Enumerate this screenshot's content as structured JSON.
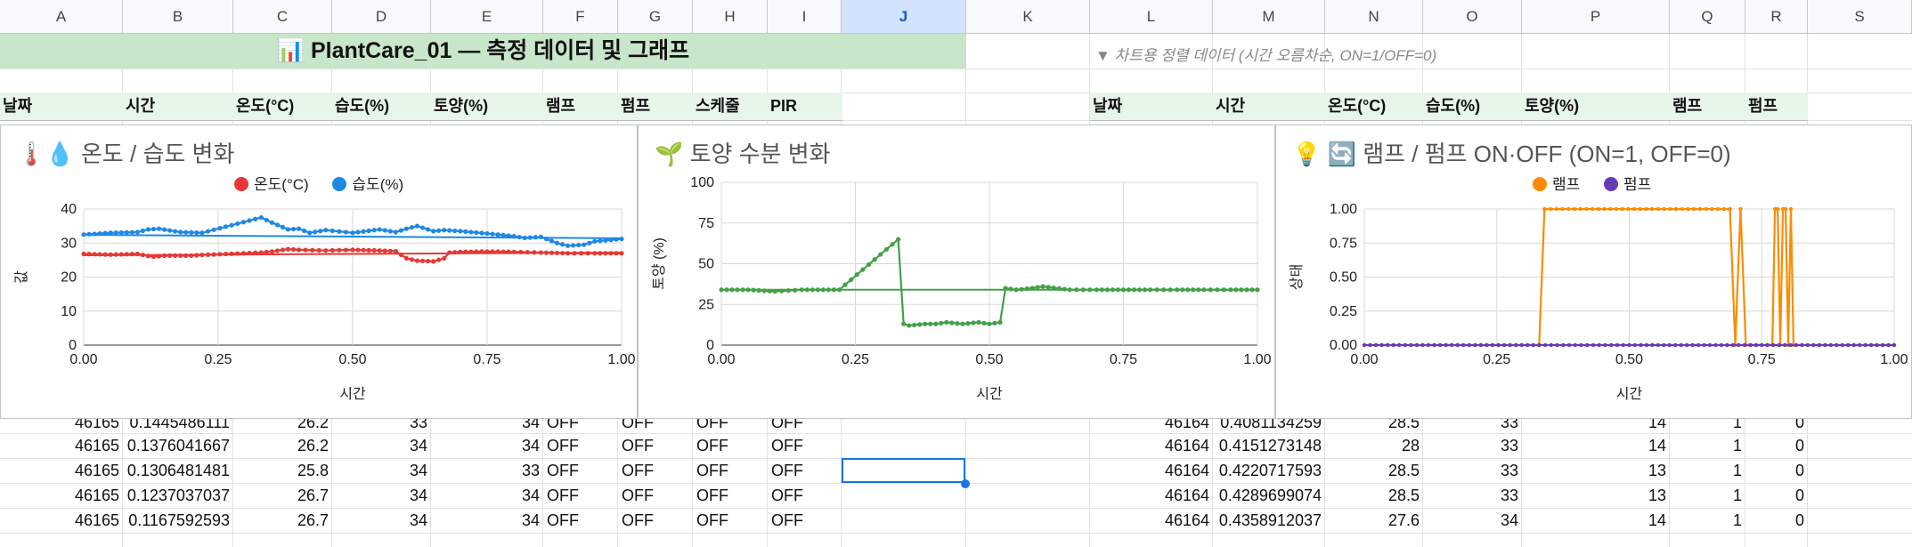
{
  "columns": [
    "A",
    "B",
    "C",
    "D",
    "E",
    "F",
    "G",
    "H",
    "I",
    "J",
    "K",
    "L",
    "M",
    "N",
    "O",
    "P",
    "Q",
    "R",
    "S"
  ],
  "selected_column": "J",
  "title": "📊 PlantCare_01 — 측정 데이터 및 그래프",
  "note": "▼ 차트용 정렬 데이터 (시간 오름차순, ON=1/OFF=0)",
  "left_headers": [
    "날짜",
    "시간",
    "온도(°C)",
    "습도(%)",
    "토양(%)",
    "램프",
    "펌프",
    "스케줄",
    "PIR"
  ],
  "right_headers": [
    "날짜",
    "시간",
    "온도(°C)",
    "습도(%)",
    "토양(%)",
    "램프",
    "펌프"
  ],
  "left_rows": [
    [
      "46165",
      "0.1445486111",
      "26.2",
      "33",
      "34",
      "OFF",
      "OFF",
      "OFF",
      "OFF"
    ],
    [
      "46165",
      "0.1376041667",
      "26.2",
      "34",
      "34",
      "OFF",
      "OFF",
      "OFF",
      "OFF"
    ],
    [
      "46165",
      "0.1306481481",
      "25.8",
      "34",
      "33",
      "OFF",
      "OFF",
      "OFF",
      "OFF"
    ],
    [
      "46165",
      "0.1237037037",
      "26.7",
      "34",
      "34",
      "OFF",
      "OFF",
      "OFF",
      "OFF"
    ],
    [
      "46165",
      "0.1167592593",
      "26.7",
      "34",
      "34",
      "OFF",
      "OFF",
      "OFF",
      "OFF"
    ]
  ],
  "right_rows": [
    [
      "46164",
      "0.4081134259",
      "28.5",
      "33",
      "14",
      "1",
      "0"
    ],
    [
      "46164",
      "0.4151273148",
      "28",
      "33",
      "14",
      "1",
      "0"
    ],
    [
      "46164",
      "0.4220717593",
      "28.5",
      "33",
      "13",
      "1",
      "0"
    ],
    [
      "46164",
      "0.4289699074",
      "28.5",
      "33",
      "13",
      "1",
      "0"
    ],
    [
      "46164",
      "0.4358912037",
      "27.6",
      "34",
      "14",
      "1",
      "0"
    ]
  ],
  "colors": {
    "temp": "#e53935",
    "humid": "#1e88e5",
    "soil": "#43a047",
    "lamp": "#fb8c00",
    "pump": "#673ab7",
    "title_bg": "#c8e6c9",
    "header_bg": "#e8f5e9"
  },
  "chart_data": [
    {
      "type": "line",
      "title": "🌡️💧 온도 / 습도 변화",
      "xlabel": "시간",
      "ylabel": "값",
      "xlim": [
        0,
        1
      ],
      "ylim": [
        0,
        40
      ],
      "xticks": [
        "0.00",
        "0.25",
        "0.50",
        "0.75",
        "1.00"
      ],
      "yticks": [
        "0",
        "10",
        "20",
        "30",
        "40"
      ],
      "legend": "top",
      "grid": true,
      "series": [
        {
          "name": "온도(°C)",
          "color": "#e53935",
          "x": [
            0.0,
            0.05,
            0.1,
            0.12,
            0.13,
            0.15,
            0.2,
            0.22,
            0.33,
            0.35,
            0.38,
            0.4,
            0.45,
            0.5,
            0.55,
            0.58,
            0.6,
            0.62,
            0.65,
            0.67,
            0.68,
            0.7,
            0.75,
            0.8,
            0.85,
            0.9,
            0.95,
            1.0
          ],
          "y": [
            26.8,
            26.6,
            26.8,
            26.2,
            26.0,
            26.3,
            26.3,
            26.5,
            27.2,
            27.5,
            28.2,
            28.0,
            27.8,
            28.0,
            27.8,
            27.6,
            25.5,
            24.8,
            24.6,
            25.5,
            27.2,
            27.4,
            27.5,
            27.4,
            27.2,
            27.0,
            27.0,
            27.0
          ]
        },
        {
          "name": "습도(%)",
          "color": "#1e88e5",
          "x": [
            0.0,
            0.05,
            0.1,
            0.12,
            0.14,
            0.18,
            0.22,
            0.33,
            0.35,
            0.38,
            0.4,
            0.42,
            0.45,
            0.5,
            0.55,
            0.58,
            0.6,
            0.62,
            0.65,
            0.67,
            0.7,
            0.75,
            0.8,
            0.82,
            0.85,
            0.88,
            0.9,
            0.93,
            0.95,
            1.0
          ],
          "y": [
            32.5,
            33.0,
            33.2,
            34.0,
            34.2,
            33.2,
            33.0,
            37.5,
            36.0,
            34.0,
            34.2,
            33.0,
            33.8,
            33.0,
            34.0,
            33.2,
            34.2,
            35.0,
            33.5,
            33.8,
            33.5,
            32.8,
            32.0,
            31.5,
            31.8,
            30.0,
            29.2,
            29.5,
            30.5,
            31.2
          ]
        }
      ],
      "trendlines": [
        {
          "series": "온도(°C)",
          "y0": 26.4,
          "y1": 27.2
        },
        {
          "series": "습도(%)",
          "y0": 32.4,
          "y1": 31.4
        }
      ]
    },
    {
      "type": "line",
      "title": "🌱 토양 수분 변화",
      "xlabel": "시간",
      "ylabel": "토양 (%)",
      "xlim": [
        0,
        1
      ],
      "ylim": [
        0,
        100
      ],
      "xticks": [
        "0.00",
        "0.25",
        "0.50",
        "0.75",
        "1.00"
      ],
      "yticks": [
        "0",
        "25",
        "50",
        "75",
        "100"
      ],
      "grid": true,
      "series": [
        {
          "name": "토양(%)",
          "color": "#43a047",
          "x": [
            0.0,
            0.05,
            0.1,
            0.15,
            0.2,
            0.22,
            0.33,
            0.34,
            0.35,
            0.38,
            0.4,
            0.42,
            0.45,
            0.48,
            0.5,
            0.52,
            0.53,
            0.55,
            0.58,
            0.6,
            0.65,
            0.7,
            0.75,
            0.8,
            0.85,
            0.9,
            0.95,
            1.0
          ],
          "y": [
            34,
            34,
            33,
            34,
            34,
            34,
            65,
            13,
            12,
            13,
            13,
            14,
            13,
            14,
            13,
            14,
            35,
            34,
            35,
            36,
            34,
            34,
            34,
            34,
            34,
            34,
            34,
            34
          ]
        }
      ],
      "trendlines": [
        {
          "series": "토양(%)",
          "y0": 34,
          "y1": 34
        }
      ]
    },
    {
      "type": "line",
      "title": "💡 🔄 램프 / 펌프 ON·OFF (ON=1, OFF=0)",
      "xlabel": "시간",
      "ylabel": "상태",
      "xlim": [
        0,
        1
      ],
      "ylim": [
        0,
        1
      ],
      "xticks": [
        "0.00",
        "0.25",
        "0.50",
        "0.75",
        "1.00"
      ],
      "yticks": [
        "0.00",
        "0.25",
        "0.50",
        "0.75",
        "1.00"
      ],
      "legend": "top",
      "grid": true,
      "series": [
        {
          "name": "램프",
          "color": "#fb8c00",
          "x": [
            0.0,
            0.22,
            0.33,
            0.34,
            0.69,
            0.7,
            0.71,
            0.72,
            0.73,
            0.77,
            0.775,
            0.78,
            0.785,
            0.79,
            0.795,
            0.8,
            0.805,
            0.81,
            0.815,
            1.0
          ],
          "y": [
            0,
            0,
            0,
            1,
            1,
            0,
            1,
            0,
            0,
            0,
            1,
            1,
            0,
            1,
            1,
            0,
            1,
            0,
            0,
            0
          ]
        },
        {
          "name": "펌프",
          "color": "#673ab7",
          "x": [
            0.0,
            0.22,
            0.33,
            0.5,
            0.75,
            1.0
          ],
          "y": [
            0,
            0,
            0,
            0,
            0,
            0
          ]
        }
      ]
    }
  ]
}
